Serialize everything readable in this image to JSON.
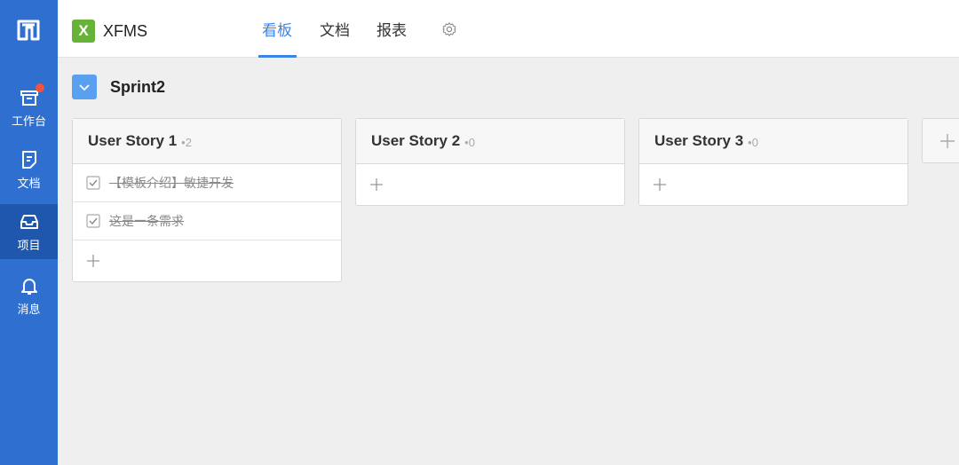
{
  "app": {
    "name": "XFMS",
    "brand_letter": "X",
    "brand_color": "#67b33a",
    "accent_color": "#3b84e8",
    "rail_color": "#2f6fd0"
  },
  "rail": {
    "items": [
      {
        "label": "工作台",
        "icon": "inbox-box-icon",
        "badge": true
      },
      {
        "label": "文档",
        "icon": "document-icon",
        "badge": false
      },
      {
        "label": "项目",
        "icon": "project-tray-icon",
        "active": true
      },
      {
        "label": "消息",
        "icon": "bell-icon",
        "badge": false
      }
    ]
  },
  "header": {
    "tabs": [
      {
        "label": "看板",
        "active": true
      },
      {
        "label": "文档",
        "active": false
      },
      {
        "label": "报表",
        "active": false
      }
    ],
    "settings_icon": "gear-icon"
  },
  "sprint": {
    "title": "Sprint2"
  },
  "columns": [
    {
      "title": "User Story 1",
      "count": "•2",
      "tasks": [
        {
          "text": "【模板介绍】敏捷开发",
          "done": true
        },
        {
          "text": "这是一条需求",
          "done": true
        }
      ]
    },
    {
      "title": "User Story 2",
      "count": "•0",
      "tasks": []
    },
    {
      "title": "User Story 3",
      "count": "•0",
      "tasks": []
    }
  ]
}
